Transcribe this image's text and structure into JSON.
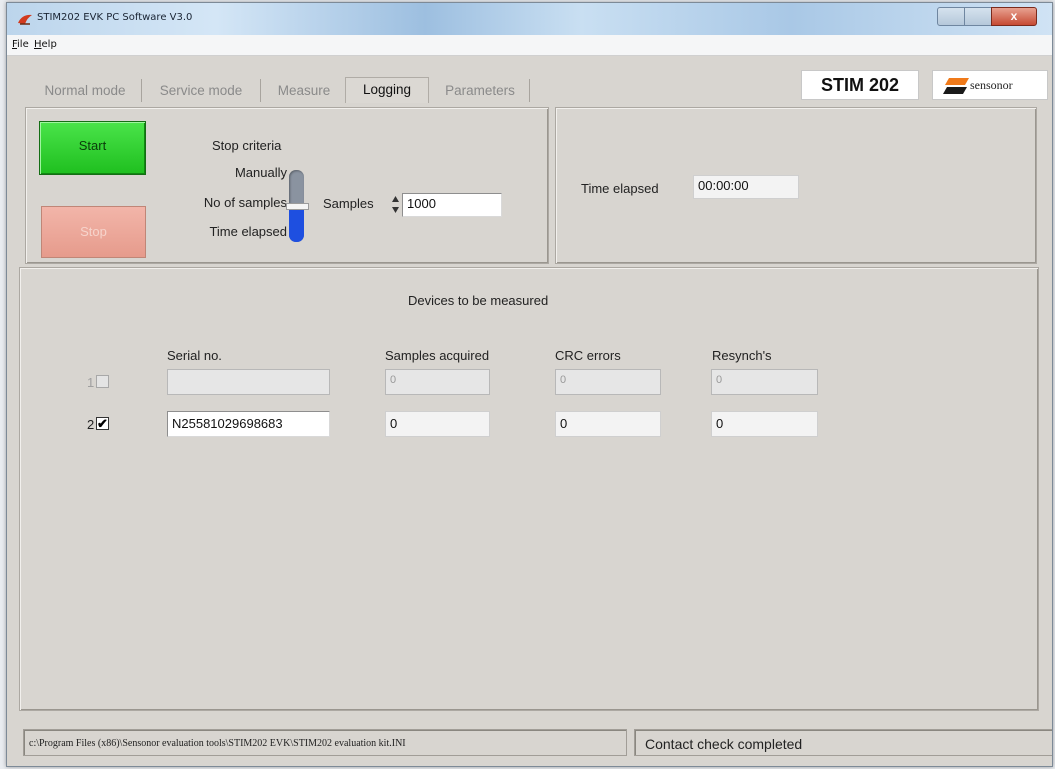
{
  "window": {
    "title": "STIM202 EVK PC Software V3.0",
    "menu": [
      {
        "label": "File"
      },
      {
        "label": "Help"
      }
    ],
    "close_glyph": "x"
  },
  "tabs": [
    {
      "label": "Normal mode",
      "active": false
    },
    {
      "label": "Service mode",
      "active": false
    },
    {
      "label": "Measure",
      "active": false
    },
    {
      "label": "Logging",
      "active": true
    },
    {
      "label": "Parameters",
      "active": false
    }
  ],
  "branding": {
    "product": "STIM 202",
    "company": "sensonor"
  },
  "logging": {
    "start_label": "Start",
    "stop_label": "Stop",
    "stop_criteria": {
      "title": "Stop criteria",
      "options": [
        "Manually",
        "No of samples",
        "Time elapsed"
      ],
      "selected": "No of samples"
    },
    "samples": {
      "label": "Samples",
      "value": "1000"
    },
    "time_elapsed": {
      "label": "Time elapsed",
      "value": "00:00:00"
    }
  },
  "devices": {
    "title": "Devices to be measured",
    "columns": {
      "serial": "Serial no.",
      "samples": "Samples acquired",
      "crc": "CRC errors",
      "resynch": "Resynch's"
    },
    "rows": [
      {
        "index": "1",
        "checked": false,
        "enabled": false,
        "serial": "",
        "samples": "0",
        "crc": "0",
        "resynch": "0"
      },
      {
        "index": "2",
        "checked": true,
        "enabled": true,
        "serial": "N25581029698683",
        "samples": "0",
        "crc": "0",
        "resynch": "0"
      }
    ],
    "check_glyph": "✔"
  },
  "status": {
    "path": "c:\\Program Files (x86)\\Sensonor evaluation tools\\STIM202 EVK\\STIM202 evaluation kit.INI",
    "message": "Contact check completed"
  },
  "colors": {
    "start_green": "#22c522",
    "stop_pink": "#e69b8c",
    "slider_blue": "#1e4fe0"
  }
}
